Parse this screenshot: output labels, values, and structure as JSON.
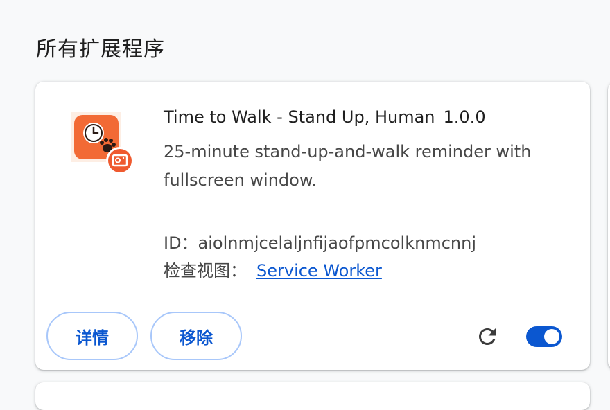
{
  "section": {
    "title": "所有扩展程序"
  },
  "extension": {
    "name": "Time to Walk - Stand Up, Human",
    "version": "1.0.0",
    "description": "25-minute stand-up-and-walk reminder with fullscreen window.",
    "id_text": "ID：aiolnmjcelaljnfijaofpmcolknmcnnj",
    "inspect_label": "检查视图：",
    "inspect_link": "Service Worker",
    "icon": "clock-paw-icon",
    "badge_icon": "camera-badge-icon"
  },
  "actions": {
    "details_label": "详情",
    "remove_label": "移除",
    "reload_icon": "reload-icon",
    "enabled": true
  },
  "colors": {
    "accent": "#0b57d0",
    "button_border": "#a8c7fa",
    "icon_orange": "#f26a35",
    "icon_bg": "#fdeee4"
  }
}
